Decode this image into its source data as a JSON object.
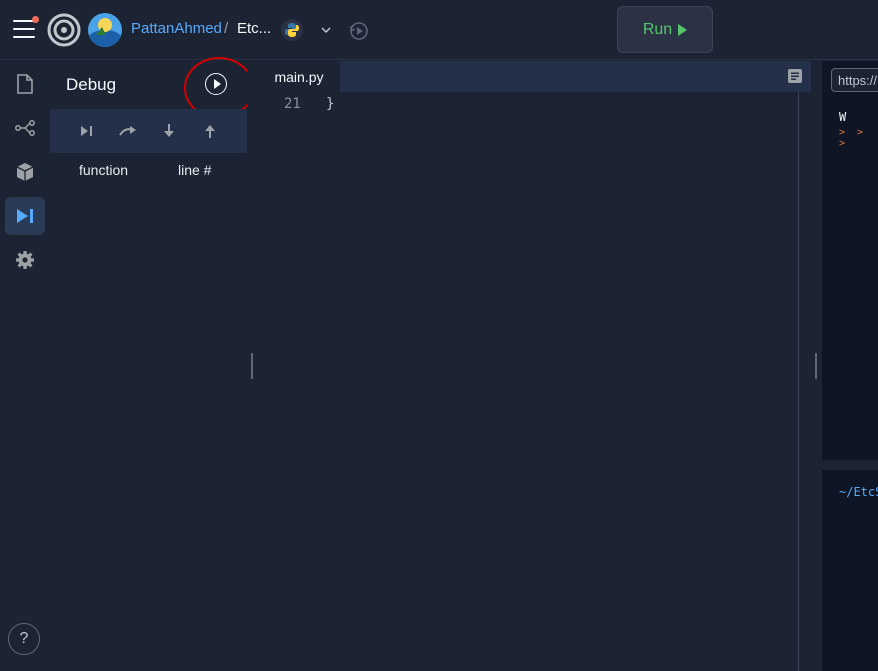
{
  "header": {
    "username": "PattanAhmed",
    "separator": "/",
    "repl_name": "Etc...",
    "run_label": "Run"
  },
  "debug": {
    "title": "Debug",
    "columns": [
      "function",
      "line #"
    ]
  },
  "editor": {
    "tab_name": "main.py",
    "line_number": "21",
    "line_text": "}"
  },
  "webview": {
    "url_text": "https://"
  },
  "console": {
    "output_first": "W",
    "output_arrows": "> > >"
  },
  "shell": {
    "prompt": "~/EtcS"
  },
  "help": {
    "label": "?"
  },
  "colors": {
    "accent_link": "#57abff",
    "run_green": "#58c66b",
    "highlight_red": "#d50000",
    "background": "#1c2333"
  }
}
